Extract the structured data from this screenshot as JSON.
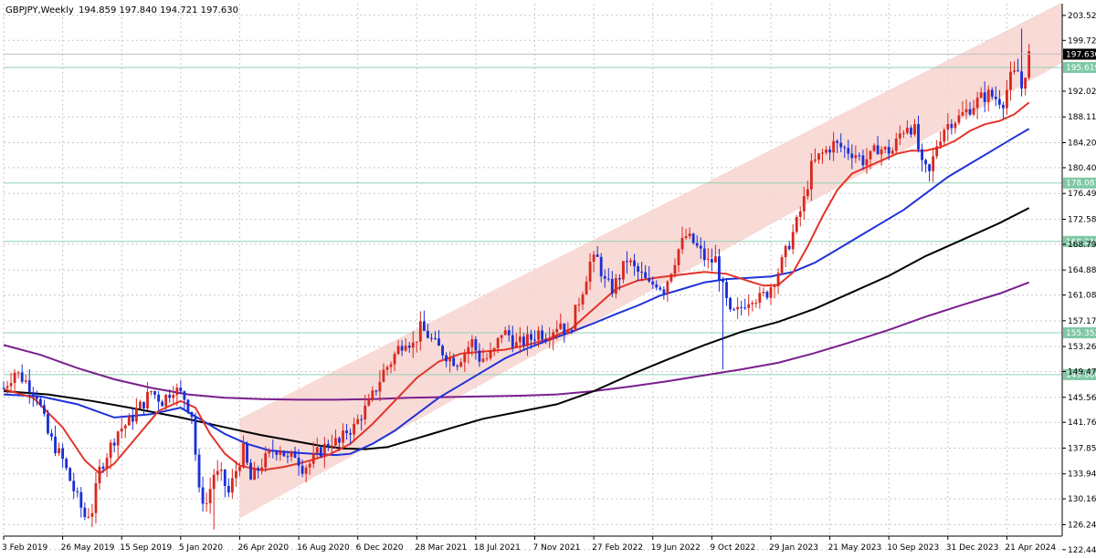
{
  "header": {
    "symbol": "GBPJPY,Weekly",
    "ohlc": "194.859 197.840 194.721 197.630"
  },
  "colors": {
    "channel_fill": "#f7d3d0",
    "bull": "#d9281f",
    "bear": "#1a2fd6",
    "ma_red": "#e3342a",
    "ma_blue": "#1f32d8",
    "ma_black": "#000000",
    "ma_purple": "#7a1f8c",
    "level": "#8fd2b4",
    "level_label_bg": "#7fc8a5",
    "grid": "#c8c8c8"
  },
  "chart_data": {
    "type": "candlestick",
    "title": "GBPJPY,Weekly",
    "ylim": [
      124.5,
      205.3
    ],
    "y_ticks": [
      "203.520",
      "199.725",
      "192.020",
      "188.110",
      "184.200",
      "180.405",
      "176.495",
      "172.585",
      "168.790",
      "164.880",
      "161.085",
      "157.175",
      "153.265",
      "149.470",
      "145.560",
      "141.765",
      "137.855",
      "133.945",
      "130.160",
      "126.240",
      "122.445"
    ],
    "x_ticks": [
      "3 Feb 2019",
      "26 May 2019",
      "15 Sep 2019",
      "5 Jan 2020",
      "26 Apr 2020",
      "16 Aug 2020",
      "6 Dec 2020",
      "28 Mar 2021",
      "18 Jul 2021",
      "7 Nov 2021",
      "27 Feb 2022",
      "19 Jun 2022",
      "9 Oct 2022",
      "29 Jan 2023",
      "21 May 2023",
      "10 Sep 2023",
      "31 Dec 2023",
      "21 Apr 2024"
    ],
    "x_tick_weeks": [
      0,
      16,
      32,
      48,
      64,
      80,
      96,
      112,
      128,
      144,
      160,
      176,
      192,
      208,
      224,
      240,
      256,
      272
    ],
    "current_price": "197.630",
    "horizontal_levels": [
      "195.619",
      "178.081",
      "169.218",
      "155.352",
      "149.000"
    ],
    "channel": {
      "start_week": 64,
      "start_low": 127.2,
      "start_high": 142.3,
      "end_week": 287,
      "end_low": 196.3,
      "end_high": 205.5
    },
    "price_path": [
      [
        0,
        147.0
      ],
      [
        3,
        149.5
      ],
      [
        6,
        148.0
      ],
      [
        9,
        146.0
      ],
      [
        12,
        140.0
      ],
      [
        16,
        136.0
      ],
      [
        19,
        131.5
      ],
      [
        22,
        127.5
      ],
      [
        24,
        128.5
      ],
      [
        26,
        134.5
      ],
      [
        28,
        137.0
      ],
      [
        31,
        140.5
      ],
      [
        34,
        141.8
      ],
      [
        36,
        143.5
      ],
      [
        38,
        144.8
      ],
      [
        40,
        146.5
      ],
      [
        43,
        145.0
      ],
      [
        46,
        147.0
      ],
      [
        49,
        145.5
      ],
      [
        51,
        143.0
      ],
      [
        53,
        131.0
      ],
      [
        55,
        129.5
      ],
      [
        57,
        134.0
      ],
      [
        59,
        133.5
      ],
      [
        61,
        131.0
      ],
      [
        63,
        134.5
      ],
      [
        65,
        137.5
      ],
      [
        67,
        133.0
      ],
      [
        70,
        135.5
      ],
      [
        73,
        137.5
      ],
      [
        75,
        138.0
      ],
      [
        77,
        136.0
      ],
      [
        79,
        137.0
      ],
      [
        81,
        135.0
      ],
      [
        83,
        135.5
      ],
      [
        85,
        137.0
      ],
      [
        87,
        138.0
      ],
      [
        89,
        139.0
      ],
      [
        91,
        138.5
      ],
      [
        93,
        140.5
      ],
      [
        95,
        141.0
      ],
      [
        97,
        143.0
      ],
      [
        99,
        144.5
      ],
      [
        101,
        147.0
      ],
      [
        103,
        149.5
      ],
      [
        105,
        151.0
      ],
      [
        107,
        153.0
      ],
      [
        109,
        154.5
      ],
      [
        111,
        153.5
      ],
      [
        113,
        156.0
      ],
      [
        115,
        155.0
      ],
      [
        117,
        153.5
      ],
      [
        119,
        152.5
      ],
      [
        121,
        151.5
      ],
      [
        123,
        151.0
      ],
      [
        125,
        152.5
      ],
      [
        127,
        154.0
      ],
      [
        129,
        151.5
      ],
      [
        131,
        151.5
      ],
      [
        133,
        152.5
      ],
      [
        135,
        155.5
      ],
      [
        137,
        155.0
      ],
      [
        139,
        153.5
      ],
      [
        141,
        154.0
      ],
      [
        143,
        154.5
      ],
      [
        145,
        155.5
      ],
      [
        147,
        155.0
      ],
      [
        149,
        156.0
      ],
      [
        151,
        157.0
      ],
      [
        153,
        155.0
      ],
      [
        155,
        158.5
      ],
      [
        157,
        162.0
      ],
      [
        159,
        166.0
      ],
      [
        161,
        166.5
      ],
      [
        163,
        163.0
      ],
      [
        165,
        162.0
      ],
      [
        167,
        164.0
      ],
      [
        169,
        166.5
      ],
      [
        171,
        165.0
      ],
      [
        173,
        164.0
      ],
      [
        175,
        162.5
      ],
      [
        177,
        163.0
      ],
      [
        179,
        162.0
      ],
      [
        181,
        165.0
      ],
      [
        183,
        168.0
      ],
      [
        185,
        170.0
      ],
      [
        187,
        169.0
      ],
      [
        189,
        167.5
      ],
      [
        191,
        166.0
      ],
      [
        193,
        166.5
      ],
      [
        195,
        162.0
      ],
      [
        197,
        158.0
      ],
      [
        199,
        158.5
      ],
      [
        201,
        160.0
      ],
      [
        203,
        161.0
      ],
      [
        205,
        160.5
      ],
      [
        207,
        161.5
      ],
      [
        209,
        163.5
      ],
      [
        211,
        166.0
      ],
      [
        213,
        169.0
      ],
      [
        215,
        172.0
      ],
      [
        217,
        175.5
      ],
      [
        219,
        180.5
      ],
      [
        221,
        182.0
      ],
      [
        223,
        183.0
      ],
      [
        225,
        184.0
      ],
      [
        227,
        183.5
      ],
      [
        229,
        183.0
      ],
      [
        231,
        182.5
      ],
      [
        233,
        181.5
      ],
      [
        235,
        182.0
      ],
      [
        237,
        183.5
      ],
      [
        239,
        183.0
      ],
      [
        241,
        183.0
      ],
      [
        243,
        185.5
      ],
      [
        245,
        187.0
      ],
      [
        247,
        186.0
      ],
      [
        249,
        180.5
      ],
      [
        251,
        179.5
      ],
      [
        253,
        184.0
      ],
      [
        255,
        186.5
      ],
      [
        257,
        187.5
      ],
      [
        259,
        188.0
      ],
      [
        261,
        189.0
      ],
      [
        263,
        190.0
      ],
      [
        265,
        191.0
      ],
      [
        267,
        191.5
      ],
      [
        269,
        191.0
      ],
      [
        271,
        190.5
      ],
      [
        273,
        194.0
      ],
      [
        275,
        195.0
      ],
      [
        276,
        192.5
      ],
      [
        277,
        195.0
      ],
      [
        278,
        197.5
      ]
    ],
    "spikes": [
      [
        57,
        125.5
      ],
      [
        195,
        149.8
      ],
      [
        276,
        201.5
      ]
    ],
    "ma_red": [
      [
        0,
        146.8
      ],
      [
        8,
        145.5
      ],
      [
        16,
        141.0
      ],
      [
        22,
        136.0
      ],
      [
        26,
        134.0
      ],
      [
        30,
        135.5
      ],
      [
        36,
        139.5
      ],
      [
        42,
        143.5
      ],
      [
        48,
        145.0
      ],
      [
        52,
        144.0
      ],
      [
        56,
        140.0
      ],
      [
        60,
        137.0
      ],
      [
        64,
        135.2
      ],
      [
        70,
        134.5
      ],
      [
        76,
        135.0
      ],
      [
        82,
        135.8
      ],
      [
        88,
        136.8
      ],
      [
        94,
        138.5
      ],
      [
        100,
        141.5
      ],
      [
        106,
        145.0
      ],
      [
        112,
        148.5
      ],
      [
        118,
        151.0
      ],
      [
        124,
        152.2
      ],
      [
        130,
        152.5
      ],
      [
        136,
        152.8
      ],
      [
        142,
        153.5
      ],
      [
        148,
        154.5
      ],
      [
        154,
        156.0
      ],
      [
        160,
        159.0
      ],
      [
        166,
        162.0
      ],
      [
        172,
        163.3
      ],
      [
        178,
        163.8
      ],
      [
        184,
        164.2
      ],
      [
        190,
        164.6
      ],
      [
        196,
        164.3
      ],
      [
        202,
        163.2
      ],
      [
        206,
        162.5
      ],
      [
        210,
        162.6
      ],
      [
        214,
        164.5
      ],
      [
        218,
        168.5
      ],
      [
        222,
        173.0
      ],
      [
        226,
        177.0
      ],
      [
        230,
        179.5
      ],
      [
        234,
        180.5
      ],
      [
        238,
        181.5
      ],
      [
        242,
        182.5
      ],
      [
        246,
        183.0
      ],
      [
        250,
        183.0
      ],
      [
        254,
        183.5
      ],
      [
        258,
        184.5
      ],
      [
        262,
        186.0
      ],
      [
        266,
        187.0
      ],
      [
        270,
        187.5
      ],
      [
        274,
        188.5
      ],
      [
        278,
        190.3
      ]
    ],
    "ma_blue": [
      [
        0,
        146.0
      ],
      [
        10,
        145.7
      ],
      [
        20,
        144.5
      ],
      [
        30,
        142.5
      ],
      [
        40,
        143.0
      ],
      [
        48,
        144.0
      ],
      [
        54,
        142.0
      ],
      [
        60,
        140.0
      ],
      [
        66,
        138.5
      ],
      [
        72,
        137.5
      ],
      [
        78,
        137.2
      ],
      [
        84,
        137.0
      ],
      [
        90,
        136.8
      ],
      [
        94,
        137.0
      ],
      [
        100,
        138.5
      ],
      [
        106,
        140.5
      ],
      [
        112,
        143.0
      ],
      [
        118,
        145.5
      ],
      [
        124,
        147.5
      ],
      [
        130,
        149.5
      ],
      [
        136,
        151.5
      ],
      [
        142,
        153.0
      ],
      [
        148,
        154.3
      ],
      [
        154,
        155.5
      ],
      [
        160,
        156.8
      ],
      [
        166,
        158.2
      ],
      [
        172,
        159.5
      ],
      [
        178,
        161.0
      ],
      [
        184,
        162.0
      ],
      [
        190,
        163.0
      ],
      [
        196,
        163.5
      ],
      [
        202,
        163.7
      ],
      [
        208,
        163.9
      ],
      [
        214,
        164.6
      ],
      [
        220,
        166.0
      ],
      [
        226,
        168.0
      ],
      [
        232,
        170.0
      ],
      [
        238,
        172.0
      ],
      [
        244,
        174.0
      ],
      [
        250,
        176.5
      ],
      [
        256,
        179.0
      ],
      [
        262,
        181.0
      ],
      [
        268,
        183.0
      ],
      [
        274,
        185.0
      ],
      [
        278,
        186.3
      ]
    ],
    "ma_black": [
      [
        0,
        146.5
      ],
      [
        12,
        146.0
      ],
      [
        24,
        145.0
      ],
      [
        36,
        143.8
      ],
      [
        48,
        142.5
      ],
      [
        60,
        141.0
      ],
      [
        70,
        139.8
      ],
      [
        80,
        138.8
      ],
      [
        86,
        138.2
      ],
      [
        92,
        137.8
      ],
      [
        98,
        137.7
      ],
      [
        104,
        138.0
      ],
      [
        110,
        139.0
      ],
      [
        116,
        140.0
      ],
      [
        122,
        141.0
      ],
      [
        130,
        142.3
      ],
      [
        140,
        143.4
      ],
      [
        150,
        144.5
      ],
      [
        160,
        146.5
      ],
      [
        170,
        149.0
      ],
      [
        180,
        151.3
      ],
      [
        190,
        153.5
      ],
      [
        200,
        155.5
      ],
      [
        210,
        157.0
      ],
      [
        220,
        159.0
      ],
      [
        230,
        161.5
      ],
      [
        240,
        164.0
      ],
      [
        250,
        167.0
      ],
      [
        260,
        169.5
      ],
      [
        270,
        172.0
      ],
      [
        278,
        174.3
      ]
    ],
    "ma_purple": [
      [
        0,
        153.5
      ],
      [
        10,
        152.0
      ],
      [
        20,
        150.0
      ],
      [
        30,
        148.3
      ],
      [
        40,
        147.0
      ],
      [
        50,
        146.0
      ],
      [
        60,
        145.5
      ],
      [
        70,
        145.3
      ],
      [
        80,
        145.2
      ],
      [
        90,
        145.2
      ],
      [
        100,
        145.3
      ],
      [
        110,
        145.5
      ],
      [
        120,
        145.6
      ],
      [
        130,
        145.7
      ],
      [
        140,
        145.8
      ],
      [
        150,
        146.0
      ],
      [
        160,
        146.5
      ],
      [
        170,
        147.2
      ],
      [
        180,
        148.0
      ],
      [
        190,
        148.9
      ],
      [
        200,
        149.8
      ],
      [
        210,
        150.8
      ],
      [
        220,
        152.3
      ],
      [
        230,
        154.0
      ],
      [
        240,
        155.8
      ],
      [
        250,
        157.8
      ],
      [
        260,
        159.6
      ],
      [
        270,
        161.3
      ],
      [
        278,
        163.0
      ]
    ]
  }
}
